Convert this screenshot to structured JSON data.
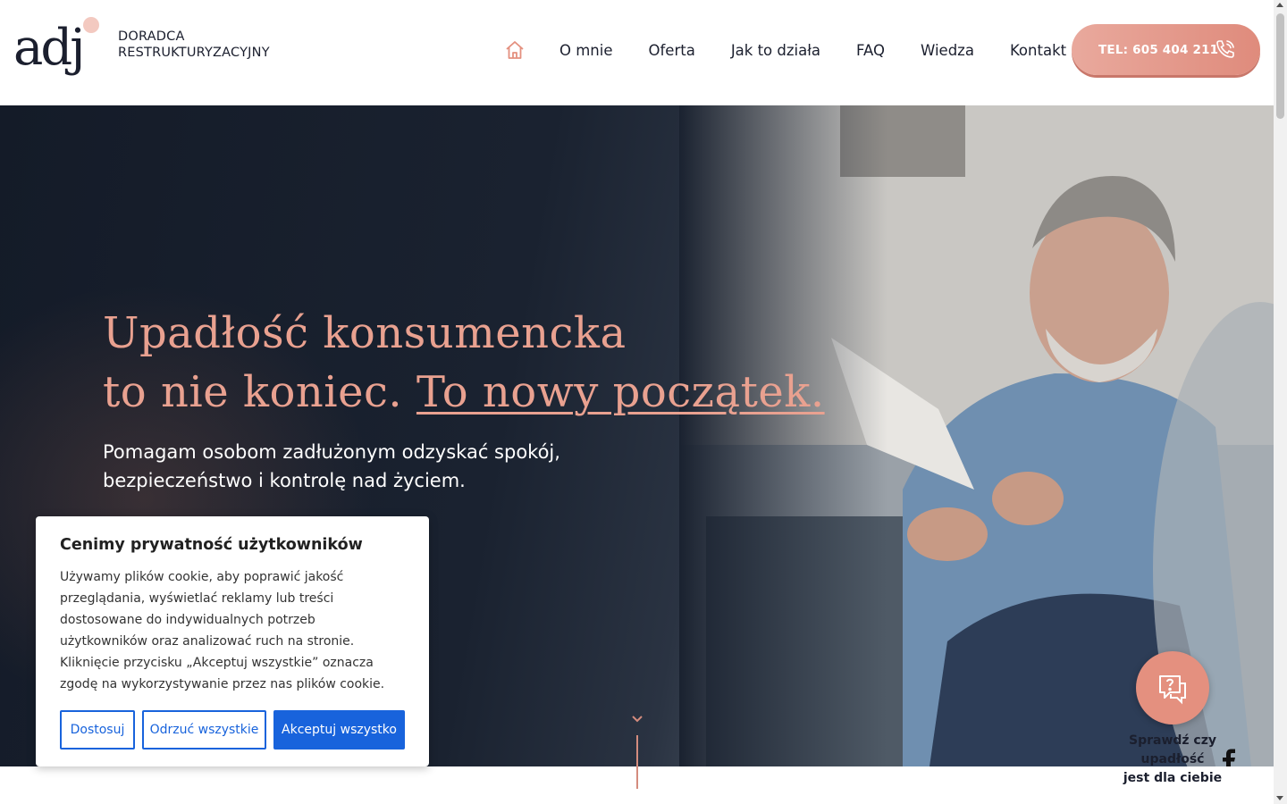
{
  "brand": {
    "logo_text": "adj",
    "subtitle_line1": "DORADCA",
    "subtitle_line2": "RESTRUKTURYZACYJNY"
  },
  "nav": {
    "home_icon": "home-icon",
    "items": [
      {
        "label": "O mnie"
      },
      {
        "label": "Oferta"
      },
      {
        "label": "Jak to działa"
      },
      {
        "label": "FAQ"
      },
      {
        "label": "Wiedza"
      },
      {
        "label": "Kontakt"
      }
    ]
  },
  "phone_button": {
    "label": "TEL: 605 404 211",
    "icon": "phone-icon"
  },
  "hero": {
    "headline_line1": "Upadłość konsumencka",
    "headline_line2a": "to nie koniec. ",
    "headline_line2b": "To nowy początek.",
    "subtext_line1": "Pomagam osobom zadłużonym odzyskać spokój,",
    "subtext_line2": "bezpieczeństwo i kontrolę nad życiem."
  },
  "cookie": {
    "title": "Cenimy prywatność użytkowników",
    "text": "Używamy plików cookie, aby poprawić jakość przeglądania, wyświetlać reklamy lub treści dostosowane do indywidualnych potrzeb użytkowników oraz analizować ruch na stronie. Kliknięcie przycisku „Akceptuj wszystkie” oznacza zgodę na wykorzystywanie przez nas plików cookie.",
    "customize": "Dostosuj",
    "reject": "Odrzuć wszystkie",
    "accept": "Akceptuj wszystko"
  },
  "widget": {
    "label_line1": "Sprawdź czy upadłość",
    "label_line2": "jest dla ciebie"
  },
  "colors": {
    "accent": "#e4907f",
    "dark": "#1b1f2e",
    "cookie_blue": "#1863dc"
  }
}
